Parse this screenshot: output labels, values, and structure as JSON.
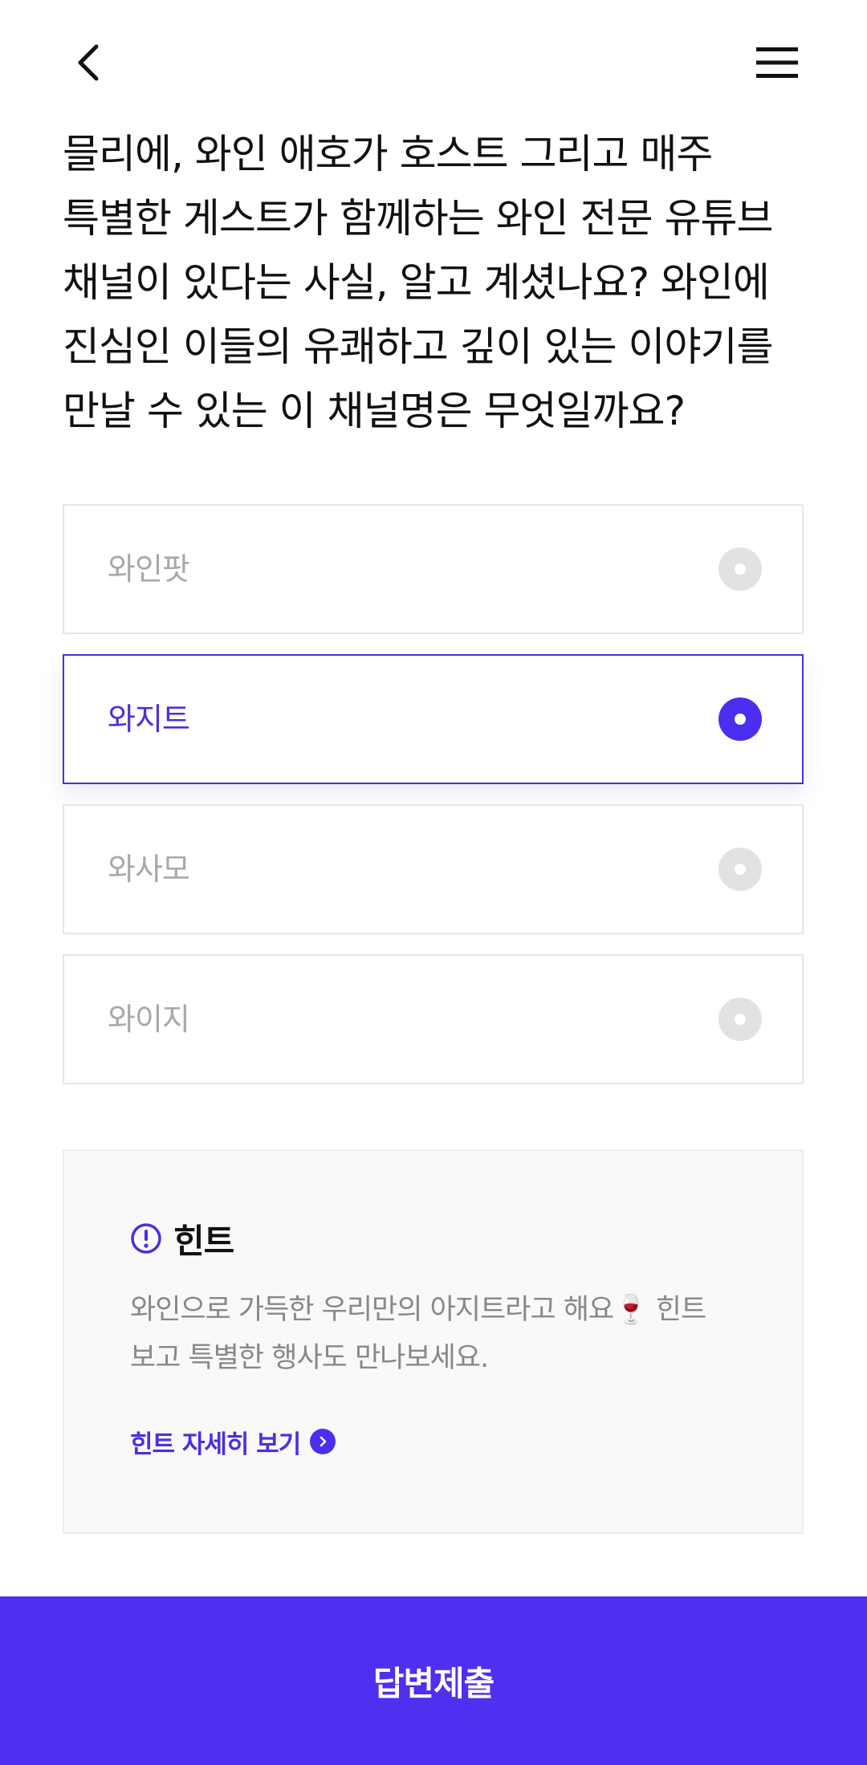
{
  "header": {
    "back_icon": "chevron-left-icon",
    "menu_icon": "hamburger-menu-icon"
  },
  "question": {
    "text": "믈리에, 와인 애호가 호스트 그리고 매주 특별한 게스트가 함께하는 와인 전문 유튜브 채널이 있다는 사실, 알고 계셨나요? 와인에 진심인 이들의 유쾌하고 깊이 있는 이야기를 만날 수 있는 이 채널명은 무엇일까요?"
  },
  "options": [
    {
      "label": "와인팟",
      "selected": false
    },
    {
      "label": "와지트",
      "selected": true
    },
    {
      "label": "와사모",
      "selected": false
    },
    {
      "label": "와이지",
      "selected": false
    }
  ],
  "hint": {
    "icon": "exclamation-circle-icon",
    "title": "힌트",
    "text": "와인으로 가득한 우리만의 아지트라고 해요🍷 힌트 보고 특별한 행사도 만나보세요.",
    "link_label": "힌트 자세히 보기",
    "link_icon": "chevron-right-circle-icon"
  },
  "submit": {
    "label": "답변제출"
  },
  "colors": {
    "accent": "#4f2ff0",
    "selected_border": "#4a30d6",
    "unselected_text": "#a8a8a8",
    "radio_off": "#e2e2e2"
  }
}
